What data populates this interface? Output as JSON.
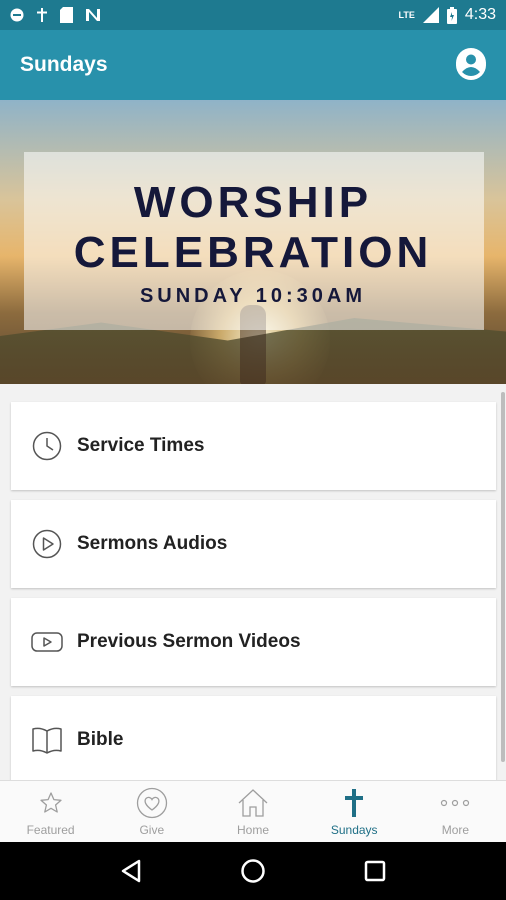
{
  "status_bar": {
    "time": "4:33",
    "network": "LTE",
    "icons": [
      "do-not-disturb-icon",
      "cross-icon",
      "sd-card-icon",
      "n-icon",
      "signal-icon",
      "battery-icon"
    ]
  },
  "app_bar": {
    "title": "Sundays",
    "profile_icon": "account-circle-icon"
  },
  "hero": {
    "line1": "WORSHIP",
    "line2": "CELEBRATION",
    "line3": "SUNDAY 10:30AM"
  },
  "menu": [
    {
      "label": "Service Times",
      "icon": "clock-icon"
    },
    {
      "label": "Sermons Audios",
      "icon": "play-circle-icon"
    },
    {
      "label": "Previous Sermon Videos",
      "icon": "video-play-icon"
    },
    {
      "label": "Bible",
      "icon": "book-icon"
    }
  ],
  "bottom_nav": [
    {
      "label": "Featured",
      "icon": "star-icon"
    },
    {
      "label": "Give",
      "icon": "heart-circle-icon"
    },
    {
      "label": "Home",
      "icon": "home-icon"
    },
    {
      "label": "Sundays",
      "icon": "cross-icon",
      "active": true
    },
    {
      "label": "More",
      "icon": "more-dots-icon"
    }
  ],
  "colors": {
    "status_bar": "#1e7a90",
    "app_bar": "#2891ab",
    "active_tab": "#1f6f86",
    "hero_text": "#15183a"
  }
}
